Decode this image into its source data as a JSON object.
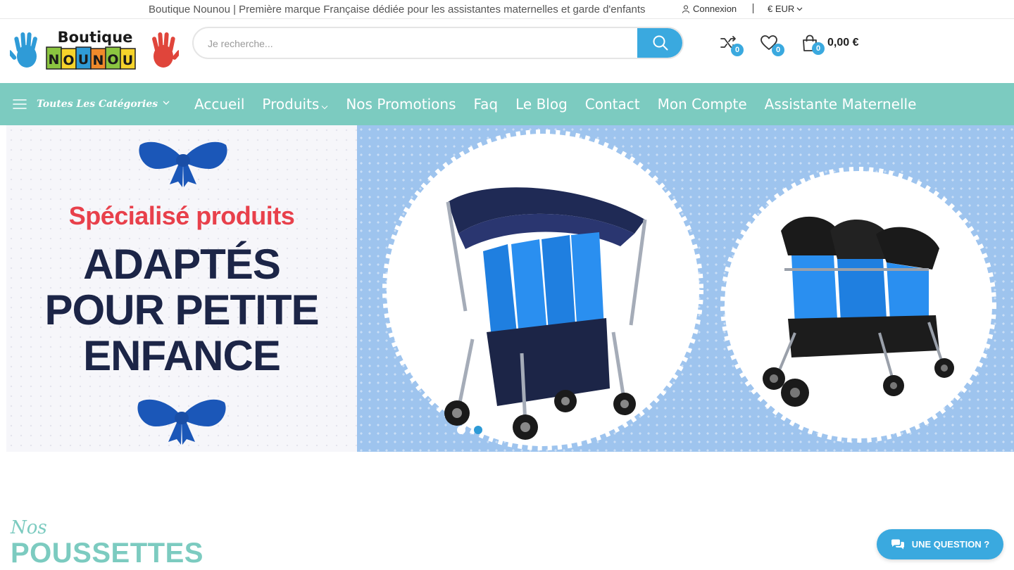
{
  "topbar": {
    "tagline": "Boutique Nounou | Première marque Française dédiée pour les assistantes maternelles et garde d'enfants",
    "login": "Connexion",
    "currency": "€ EUR"
  },
  "logo": {
    "line1": "Boutique",
    "letters": [
      "N",
      "O",
      "U",
      "N",
      "O",
      "U"
    ]
  },
  "search": {
    "placeholder": "Je recherche..."
  },
  "header": {
    "compare_count": "0",
    "wishlist_count": "0",
    "cart_count": "0",
    "cart_total": "0,00 €"
  },
  "nav": {
    "categories_label": "Toutes Les Catégories",
    "items": [
      {
        "label": "Accueil"
      },
      {
        "label": "Produits"
      },
      {
        "label": "Nos Promotions"
      },
      {
        "label": "Faq"
      },
      {
        "label": "Le Blog"
      },
      {
        "label": "Contact"
      },
      {
        "label": "Mon Compte"
      },
      {
        "label": "Assistante Maternelle"
      }
    ]
  },
  "banner": {
    "subtitle": "Spécialisé produits",
    "line1": "ADAPTÉS",
    "line2": "POUR PETITE",
    "line3": "ENFANCE",
    "slides": 2,
    "active_slide": 2
  },
  "section": {
    "pre": "Nos",
    "title": "POUSSETTES"
  },
  "chat": {
    "label": "UNE QUESTION ?"
  },
  "colors": {
    "accent": "#3aa9df",
    "nav": "#7ccbc0",
    "banner_red": "#e8404b",
    "banner_navy": "#1c2547",
    "banner_blue": "#9ec4ee"
  }
}
